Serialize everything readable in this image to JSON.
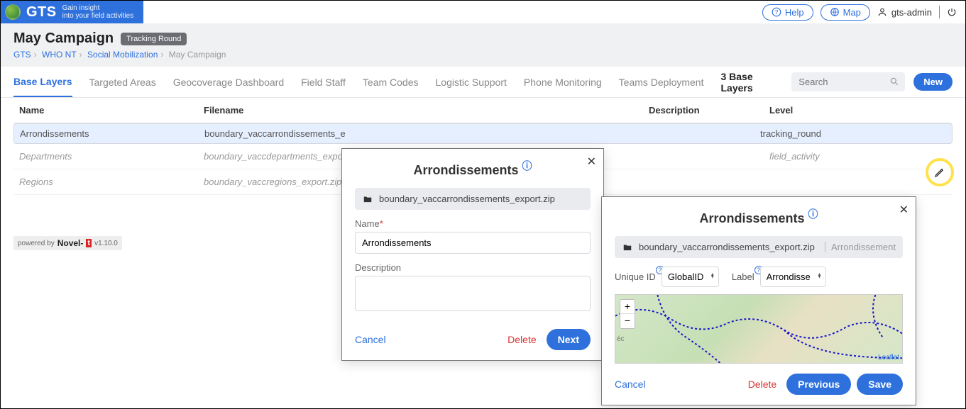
{
  "brand": {
    "name": "GTS",
    "tag1": "Gain insight",
    "tag2": "into your field activities"
  },
  "header": {
    "help": "Help",
    "map": "Map",
    "user": "gts-admin"
  },
  "page": {
    "title": "May Campaign",
    "badge": "Tracking Round",
    "crumbs": {
      "a": "GTS",
      "b": "WHO NT",
      "c": "Social Mobilization",
      "d": "May Campaign"
    }
  },
  "tabs": {
    "items": [
      "Base Layers",
      "Targeted Areas",
      "Geocoverage Dashboard",
      "Field Staff",
      "Team Codes",
      "Logistic Support",
      "Phone Monitoring",
      "Teams Deployment"
    ],
    "count": "3 Base Layers",
    "search_ph": "Search",
    "new": "New"
  },
  "table": {
    "cols": {
      "name": "Name",
      "file": "Filename",
      "desc": "Description",
      "level": "Level"
    },
    "rows": [
      {
        "name": "Arrondissements",
        "file": "boundary_vaccarrondissements_e",
        "desc": "",
        "level": "tracking_round"
      },
      {
        "name": "Departments",
        "file": "boundary_vaccdepartments_expor",
        "desc": "",
        "level": "field_activity"
      },
      {
        "name": "Regions",
        "file": "boundary_vaccregions_export.zip",
        "desc": "",
        "level": ""
      }
    ]
  },
  "footer": {
    "pb": "powered by",
    "brand": "Novel-",
    "t": "t",
    "ver": "v1.10.0"
  },
  "modal1": {
    "title": "Arrondissements",
    "file": "boundary_vaccarrondissements_export.zip",
    "name_lbl": "Name",
    "name_val": "Arrondissements",
    "desc_lbl": "Description",
    "cancel": "Cancel",
    "delete": "Delete",
    "next": "Next"
  },
  "modal2": {
    "title": "Arrondissements",
    "file": "boundary_vaccarrondissements_export.zip",
    "file_extra": "Arrondissement",
    "uid_lbl": "Unique ID",
    "uid_val": "GlobalID",
    "label_lbl": "Label",
    "label_val": "Arrondisse",
    "leaflet": "Leaflet",
    "cancel": "Cancel",
    "delete": "Delete",
    "prev": "Previous",
    "save": "Save"
  }
}
